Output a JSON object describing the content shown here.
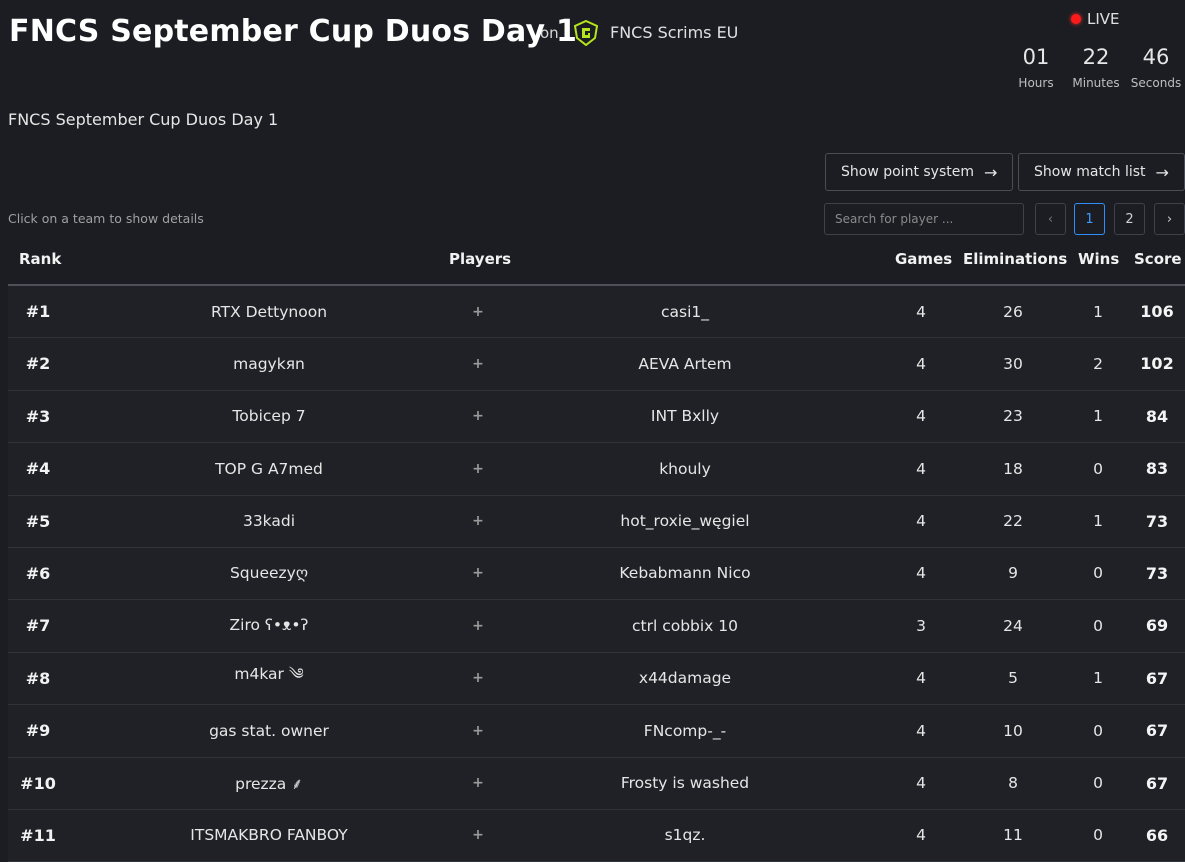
{
  "header": {
    "title": "FNCS September Cup Duos Day 1",
    "on_label": "on",
    "organizer": "FNCS Scrims EU",
    "live_label": "LIVE",
    "countdown": [
      {
        "value": "01",
        "label": "Hours"
      },
      {
        "value": "22",
        "label": "Minutes"
      },
      {
        "value": "46",
        "label": "Seconds"
      }
    ]
  },
  "subtitle": "FNCS September Cup Duos Day 1",
  "buttons": {
    "point_system": "Show point system",
    "match_list": "Show match list",
    "arrow": "→"
  },
  "hint": "Click on a team to show details",
  "search": {
    "placeholder": "Search for player ...",
    "value": ""
  },
  "pagination": {
    "prev": "‹",
    "next": "›",
    "pages": [
      "1",
      "2"
    ],
    "current": "1"
  },
  "table": {
    "headers": {
      "rank": "Rank",
      "players": "Players",
      "games": "Games",
      "eliminations": "Eliminations",
      "wins": "Wins",
      "score": "Score"
    },
    "separator": "+",
    "rows": [
      {
        "rank": "#1",
        "p1": "RTX Dettynoon",
        "p2": "casi1_",
        "games": "4",
        "elims": "26",
        "wins": "1",
        "score": "106"
      },
      {
        "rank": "#2",
        "p1": "magykяn",
        "p2": "AEVA Artem",
        "games": "4",
        "elims": "30",
        "wins": "2",
        "score": "102"
      },
      {
        "rank": "#3",
        "p1": "Tobicep 7",
        "p2": "INT Bxlly",
        "games": "4",
        "elims": "23",
        "wins": "1",
        "score": "84"
      },
      {
        "rank": "#4",
        "p1": "TOP G A7med",
        "p2": "khouly",
        "games": "4",
        "elims": "18",
        "wins": "0",
        "score": "83"
      },
      {
        "rank": "#5",
        "p1": "33kadi",
        "p2": "hot_roxie_węgiel",
        "games": "4",
        "elims": "22",
        "wins": "1",
        "score": "73"
      },
      {
        "rank": "#6",
        "p1": "Squeezyღ",
        "p2": "Kebabmann Nico",
        "games": "4",
        "elims": "9",
        "wins": "0",
        "score": "73"
      },
      {
        "rank": "#7",
        "p1": "Ziro ʕ•ᴥ•ʔ",
        "p2": "ctrl cobbix 10",
        "games": "3",
        "elims": "24",
        "wins": "0",
        "score": "69"
      },
      {
        "rank": "#8",
        "p1": "m4kar ༄",
        "p2": "x44damage",
        "games": "4",
        "elims": "5",
        "wins": "1",
        "score": "67"
      },
      {
        "rank": "#9",
        "p1": "gas stat. owner",
        "p2": "FNcomp-_-",
        "games": "4",
        "elims": "10",
        "wins": "0",
        "score": "67"
      },
      {
        "rank": "#10",
        "p1": "prezza ⸙",
        "p2": "Frosty is washed",
        "games": "4",
        "elims": "8",
        "wins": "0",
        "score": "67"
      },
      {
        "rank": "#11",
        "p1": "ITSMAKBRO FANBOY",
        "p2": "s1qz.",
        "games": "4",
        "elims": "11",
        "wins": "0",
        "score": "66"
      }
    ]
  },
  "colors": {
    "background": "#1b1d22",
    "row": "#1f2126",
    "accent": "#2f8fff",
    "live": "#ff1a1a",
    "logo": "#b5e61d"
  }
}
